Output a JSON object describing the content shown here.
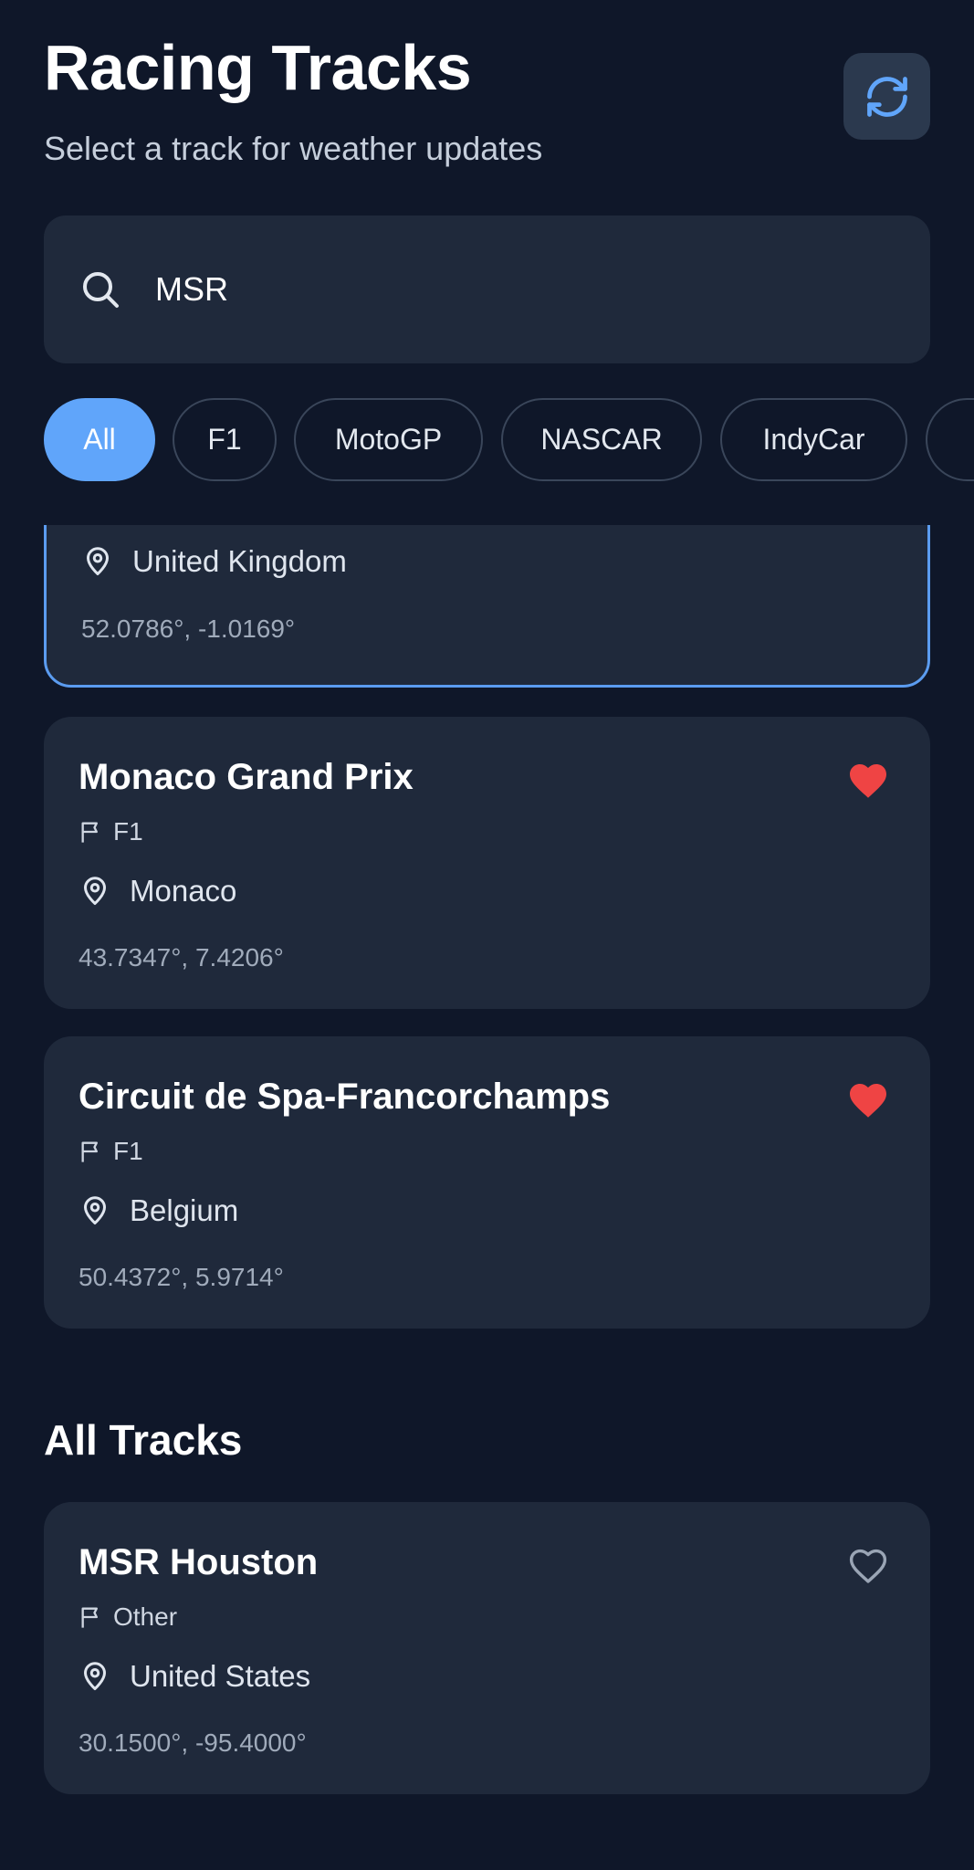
{
  "header": {
    "title": "Racing Tracks",
    "subtitle": "Select a track for weather updates",
    "refresh_icon": "refresh-icon"
  },
  "search": {
    "value": "MSR",
    "icon": "search-icon"
  },
  "filters": [
    {
      "label": "All",
      "active": true
    },
    {
      "label": "F1",
      "active": false
    },
    {
      "label": "MotoGP",
      "active": false
    },
    {
      "label": "NASCAR",
      "active": false
    },
    {
      "label": "IndyCar",
      "active": false
    }
  ],
  "favorites": [
    {
      "name": "",
      "series": "",
      "location": "United Kingdom",
      "coords": "52.0786°, -1.0169°",
      "selected": true
    },
    {
      "name": "Monaco Grand Prix",
      "series": "F1",
      "location": "Monaco",
      "coords": "43.7347°, 7.4206°",
      "favorite": true
    },
    {
      "name": "Circuit de Spa-Francorchamps",
      "series": "F1",
      "location": "Belgium",
      "coords": "50.4372°, 5.9714°",
      "favorite": true
    }
  ],
  "all_tracks": {
    "title": "All Tracks",
    "items": [
      {
        "name": "MSR Houston",
        "series": "Other",
        "location": "United States",
        "coords": "30.1500°, -95.4000°",
        "favorite": false
      }
    ]
  },
  "colors": {
    "background": "#0f1729",
    "card": "#1f293b",
    "accent": "#60a5fa",
    "favorite": "#ef4444"
  }
}
